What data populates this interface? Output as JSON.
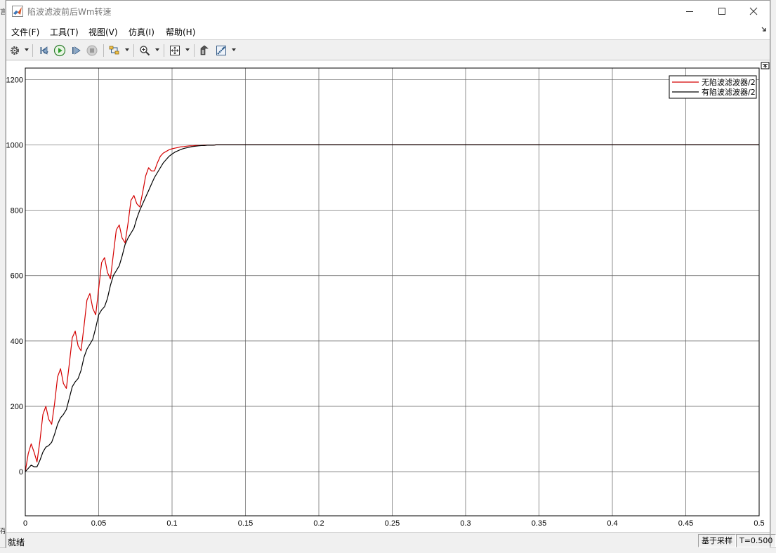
{
  "window": {
    "title": "陷波滤波前后Wm转速"
  },
  "menu": {
    "items": [
      {
        "label": "文件(F)"
      },
      {
        "label": "工具(T)"
      },
      {
        "label": "视图(V)"
      },
      {
        "label": "仿真(I)"
      },
      {
        "label": "帮助(H)"
      }
    ]
  },
  "toolbar": {
    "icons": [
      "gear-icon",
      "step-back-icon",
      "run-icon",
      "step-forward-icon",
      "stop-icon",
      "signal-selector-icon",
      "zoom-in-icon",
      "fit-axes-icon",
      "style-icon",
      "cursor-measure-icon"
    ]
  },
  "status": {
    "left": "就绪",
    "mode": "基于采样",
    "time": "T=0.500"
  },
  "edge": {
    "left_top": "言",
    "left_bottom": "存"
  },
  "colors": {
    "series_red": "#d40000",
    "series_black": "#000000",
    "grid": "#5c5c5c",
    "run_green": "#2e9e2e"
  },
  "chart_data": {
    "type": "line",
    "title": "",
    "xlabel": "",
    "ylabel": "",
    "xlim": [
      0,
      0.5
    ],
    "ylim": [
      -135,
      1235
    ],
    "grid": true,
    "legend_position": "top-right",
    "xticks": [
      "0",
      "0.05",
      "0.1",
      "0.15",
      "0.2",
      "0.25",
      "0.3",
      "0.35",
      "0.4",
      "0.45",
      "0.5"
    ],
    "yticks": [
      "0",
      "200",
      "400",
      "600",
      "800",
      "1000",
      "1200"
    ],
    "series": [
      {
        "name": "无陷波滤波器/2",
        "color": "#d40000",
        "x": [
          0,
          0.002,
          0.004,
          0.006,
          0.008,
          0.01,
          0.012,
          0.014,
          0.016,
          0.018,
          0.02,
          0.022,
          0.024,
          0.026,
          0.028,
          0.03,
          0.032,
          0.034,
          0.036,
          0.038,
          0.04,
          0.042,
          0.044,
          0.046,
          0.048,
          0.05,
          0.052,
          0.054,
          0.056,
          0.058,
          0.06,
          0.062,
          0.064,
          0.066,
          0.068,
          0.07,
          0.072,
          0.074,
          0.076,
          0.078,
          0.08,
          0.082,
          0.084,
          0.086,
          0.088,
          0.09,
          0.092,
          0.094,
          0.096,
          0.098,
          0.1,
          0.102,
          0.104,
          0.106,
          0.108,
          0.11,
          0.112,
          0.114,
          0.116,
          0.118,
          0.12,
          0.122,
          0.124,
          0.126,
          0.128,
          0.13,
          0.132,
          0.134,
          0.136,
          0.138,
          0.14,
          0.145,
          0.15,
          0.16,
          0.2,
          0.25,
          0.3,
          0.35,
          0.4,
          0.45,
          0.5
        ],
        "y": [
          0,
          55,
          85,
          60,
          30,
          95,
          175,
          200,
          160,
          145,
          210,
          290,
          315,
          270,
          255,
          330,
          410,
          430,
          385,
          370,
          445,
          525,
          545,
          500,
          480,
          560,
          640,
          655,
          610,
          590,
          665,
          740,
          755,
          715,
          700,
          760,
          830,
          845,
          820,
          810,
          855,
          905,
          930,
          920,
          920,
          945,
          965,
          975,
          980,
          985,
          988,
          990,
          992,
          994,
          995,
          996,
          997,
          997,
          998,
          998,
          998,
          999,
          999,
          999,
          999,
          1000,
          1000,
          1000,
          1000,
          1000,
          1000,
          1000,
          1000,
          1000,
          1000,
          1000,
          1000,
          1000,
          1000,
          1000,
          1000
        ]
      },
      {
        "name": "有陷波滤波器/2",
        "color": "#000000",
        "x": [
          0,
          0.002,
          0.004,
          0.006,
          0.008,
          0.01,
          0.012,
          0.014,
          0.016,
          0.018,
          0.02,
          0.022,
          0.024,
          0.026,
          0.028,
          0.03,
          0.032,
          0.034,
          0.036,
          0.038,
          0.04,
          0.042,
          0.044,
          0.046,
          0.048,
          0.05,
          0.052,
          0.054,
          0.056,
          0.058,
          0.06,
          0.062,
          0.064,
          0.066,
          0.068,
          0.07,
          0.072,
          0.074,
          0.076,
          0.078,
          0.08,
          0.082,
          0.084,
          0.086,
          0.088,
          0.09,
          0.092,
          0.094,
          0.096,
          0.098,
          0.1,
          0.102,
          0.104,
          0.106,
          0.108,
          0.11,
          0.112,
          0.114,
          0.116,
          0.118,
          0.12,
          0.122,
          0.124,
          0.126,
          0.128,
          0.13,
          0.132,
          0.134,
          0.136,
          0.138,
          0.14,
          0.145,
          0.15,
          0.16,
          0.2,
          0.25,
          0.3,
          0.35,
          0.4,
          0.45,
          0.5
        ],
        "y": [
          0,
          10,
          20,
          15,
          15,
          35,
          60,
          75,
          80,
          90,
          115,
          145,
          165,
          175,
          190,
          225,
          260,
          275,
          285,
          310,
          350,
          375,
          390,
          405,
          440,
          480,
          495,
          505,
          530,
          570,
          600,
          615,
          630,
          660,
          695,
          715,
          730,
          745,
          775,
          800,
          820,
          840,
          860,
          880,
          900,
          915,
          930,
          945,
          955,
          965,
          972,
          978,
          982,
          986,
          989,
          991,
          993,
          995,
          996,
          997,
          998,
          998,
          999,
          999,
          999,
          1000,
          1000,
          1000,
          1000,
          1000,
          1000,
          1000,
          1000,
          1000,
          1000,
          1000,
          1000,
          1000,
          1000,
          1000,
          1000
        ]
      }
    ]
  }
}
